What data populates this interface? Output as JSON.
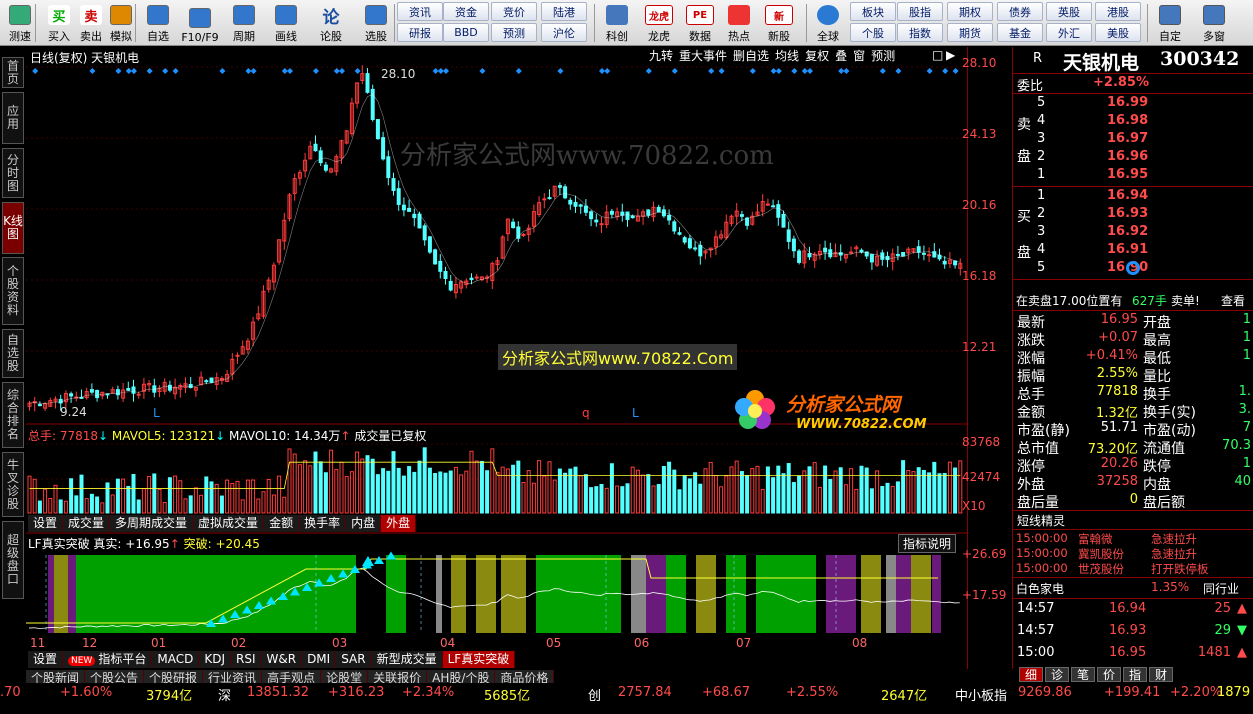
{
  "toolbar": {
    "left_buttons": [
      {
        "label": "测速",
        "icon": "speed-icon"
      },
      {
        "label": "买入",
        "icon": "buy-icon",
        "glyph": "买"
      },
      {
        "label": "卖出",
        "icon": "sell-icon",
        "glyph": "卖"
      },
      {
        "label": "模拟",
        "icon": "hammer-icon"
      },
      {
        "label": "自选",
        "icon": "star-icon"
      },
      {
        "label": "F10/F9",
        "icon": "f10-icon"
      },
      {
        "label": "周期",
        "icon": "clock-icon"
      },
      {
        "label": "画线",
        "icon": "pencil-icon"
      },
      {
        "label": "论股",
        "icon": "discuss-icon",
        "glyph": "论"
      },
      {
        "label": "选股",
        "icon": "select-stock-icon"
      }
    ],
    "grid1_top": [
      "资讯",
      "资金",
      "竞价",
      "陆港"
    ],
    "grid1_bottom": [
      "研报",
      "BBD",
      "预测",
      "沪伦"
    ],
    "mid_buttons": [
      {
        "label": "科创",
        "icon": "sci-icon"
      },
      {
        "label": "龙虎",
        "icon": "dragon-icon",
        "glyph": "龙虎"
      },
      {
        "label": "数据",
        "icon": "data-icon",
        "glyph": "PE"
      },
      {
        "label": "热点",
        "icon": "hot-icon"
      },
      {
        "label": "新股",
        "icon": "new-stock-icon",
        "glyph": "新"
      }
    ],
    "global_label": "全球",
    "grid2_top": [
      "板块",
      "股指",
      "期权",
      "债券",
      "英股",
      "港股"
    ],
    "grid2_bottom": [
      "个股",
      "指数",
      "期货",
      "基金",
      "外汇",
      "美股"
    ],
    "right_buttons": [
      {
        "label": "自定",
        "icon": "custom-icon"
      },
      {
        "label": "多窗",
        "icon": "multi-window-icon"
      }
    ]
  },
  "left_tabs": [
    "首页",
    "应用",
    "分时图",
    "K线图",
    "个股资料",
    "自选股",
    "综合排名",
    "牛叉诊股",
    "超级盘口"
  ],
  "kline": {
    "title": "日线(复权)  天银机电",
    "tools": [
      "九转",
      "重大事件",
      "删自选",
      "均线",
      "复权",
      "叠",
      "窗",
      "预测"
    ],
    "watermark1": "分析家公式网www.70822.com",
    "watermark2": "分析家公式网www.70822.Com",
    "logo_text": "分析家公式网",
    "logo_url": "WWW.70822.COM",
    "high_label": "28.10",
    "low_label": "9.24",
    "markers": [
      "L",
      "q",
      "L"
    ],
    "y_labels": [
      "28.10",
      "24.13",
      "20.16",
      "16.18",
      "12.21"
    ]
  },
  "volume": {
    "header_total": "总手: 77818",
    "mavol5": "MAVOL5: 123121",
    "mavol10": "MAVOL10: 14.34万",
    "note": "成交量已复权",
    "y_labels": [
      "83768",
      "42474",
      "X10"
    ],
    "tabs": [
      "设置",
      "成交量",
      "多周期成交量",
      "虚拟成交量",
      "金额",
      "换手率",
      "内盘",
      "外盘"
    ]
  },
  "indicator": {
    "header_name": "LF真实突破",
    "header_real": "真实: +16.95",
    "header_break": "突破: +20.45",
    "help": "指标说明",
    "y_labels": [
      "+26.69",
      "+17.59"
    ],
    "months": [
      "11",
      "12",
      "01",
      "02",
      "03",
      "04",
      "05",
      "06",
      "07",
      "08"
    ],
    "tabs": [
      "设置",
      "指标平台",
      "MACD",
      "KDJ",
      "RSI",
      "W&R",
      "DMI",
      "SAR",
      "新型成交量",
      "LF真实突破"
    ],
    "new_badge": "NEW",
    "tabs2": [
      "个股新闻",
      "个股公告",
      "个股研报",
      "行业资讯",
      "高手观点",
      "论股堂",
      "关联报价",
      "AH股/个股",
      "商品价格"
    ]
  },
  "right_panel": {
    "code_flag": "R",
    "name": "天银机电",
    "code": "300342",
    "weibi_label": "委比",
    "weibi_value": "+2.85%",
    "sell_label": "卖盘",
    "buy_label": "买盘",
    "sells": [
      {
        "lv": "5",
        "p": "16.99"
      },
      {
        "lv": "4",
        "p": "16.98"
      },
      {
        "lv": "3",
        "p": "16.97"
      },
      {
        "lv": "2",
        "p": "16.96"
      },
      {
        "lv": "1",
        "p": "16.95"
      }
    ],
    "buys": [
      {
        "lv": "1",
        "p": "16.94"
      },
      {
        "lv": "2",
        "p": "16.93"
      },
      {
        "lv": "3",
        "p": "16.92"
      },
      {
        "lv": "4",
        "p": "16.91"
      },
      {
        "lv": "5",
        "p": "16.90"
      }
    ],
    "info_line": {
      "text": "在卖盘17.00位置有",
      "qty": "627手",
      "tag": "卖单!",
      "link": "查看"
    },
    "stats": [
      {
        "l": "最新",
        "v": "16.95",
        "c": "red",
        "l2": "开盘",
        "v2": "1"
      },
      {
        "l": "涨跌",
        "v": "+0.07",
        "c": "red",
        "l2": "最高",
        "v2": "1"
      },
      {
        "l": "涨幅",
        "v": "+0.41%",
        "c": "red",
        "l2": "最低",
        "v2": "1"
      },
      {
        "l": "振幅",
        "v": "2.55%",
        "c": "yel",
        "l2": "量比",
        "v2": ""
      },
      {
        "l": "总手",
        "v": "77818",
        "c": "yel",
        "l2": "换手",
        "v2": "1."
      },
      {
        "l": "金额",
        "v": "1.32亿",
        "c": "yel",
        "l2": "换手(实)",
        "v2": "3."
      },
      {
        "l": "市盈(静)",
        "v": "51.71",
        "c": "wht",
        "l2": "市盈(动)",
        "v2": "7"
      },
      {
        "l": "总市值",
        "v": "73.20亿",
        "c": "yel",
        "l2": "流通值",
        "v2": "70.3"
      },
      {
        "l": "涨停",
        "v": "20.26",
        "c": "red",
        "l2": "跌停",
        "v2": "1"
      },
      {
        "l": "外盘",
        "v": "37258",
        "c": "red",
        "l2": "内盘",
        "v2": "40"
      },
      {
        "l": "盘后量",
        "v": "0",
        "c": "yel",
        "l2": "盘后额",
        "v2": ""
      }
    ],
    "short_title": "短线精灵",
    "short_items": [
      {
        "t": "15:00:00",
        "n": "富翰微",
        "a": "急速拉升"
      },
      {
        "t": "15:00:00",
        "n": "冀凯股份",
        "a": "急速拉升"
      },
      {
        "t": "15:00:00",
        "n": "世茂股份",
        "a": "打开跌停板"
      }
    ],
    "sector_name": "白色家电",
    "sector_pct": "1.35%",
    "sector_more": "同行业",
    "ticks": [
      {
        "t": "14:57",
        "p": "16.94",
        "v": "25",
        "dir": "up"
      },
      {
        "t": "14:57",
        "p": "16.93",
        "v": "29",
        "dir": "down"
      },
      {
        "t": "15:00",
        "p": "16.95",
        "v": "1481",
        "dir": "up"
      }
    ],
    "bottom_tabs": [
      "细",
      "诊",
      "笔",
      "价",
      "指",
      "财"
    ]
  },
  "status_bar": [
    {
      "t": ".70",
      "c": "red"
    },
    {
      "t": "+1.60%",
      "c": "red"
    },
    {
      "t": "3794亿",
      "c": "yel"
    },
    {
      "t": "深",
      "c": "wht"
    },
    {
      "t": "13851.32",
      "c": "red"
    },
    {
      "t": "+316.23",
      "c": "red"
    },
    {
      "t": "+2.34%",
      "c": "red"
    },
    {
      "t": "5685亿",
      "c": "yel"
    },
    {
      "t": "创",
      "c": "wht"
    },
    {
      "t": "2757.84",
      "c": "red"
    },
    {
      "t": "+68.67",
      "c": "red"
    },
    {
      "t": "+2.55%",
      "c": "red"
    },
    {
      "t": "2647亿",
      "c": "yel"
    },
    {
      "t": "中小板指",
      "c": "wht"
    },
    {
      "t": "9269.86",
      "c": "red"
    },
    {
      "t": "+199.41",
      "c": "red"
    },
    {
      "t": "+2.20%",
      "c": "red"
    },
    {
      "t": "1879",
      "c": "yel"
    }
  ],
  "colors": {
    "up": "#ff3b3b",
    "down": "#54ffff",
    "bg": "#000000",
    "grid": "#800000",
    "price_yellow": "#ffff33",
    "ind_green": "#00a000",
    "ind_purple": "#6a1a7a",
    "ind_olive": "#8a8a10",
    "ind_gray": "#888888"
  }
}
